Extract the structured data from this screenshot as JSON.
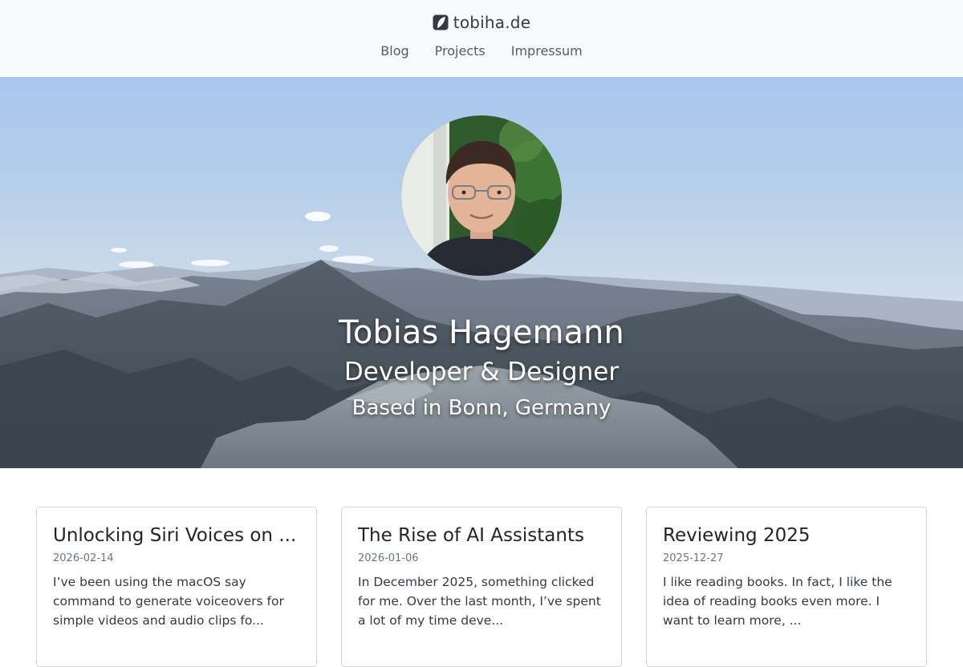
{
  "header": {
    "brand": "tobiha.de",
    "nav": [
      {
        "label": "Blog"
      },
      {
        "label": "Projects"
      },
      {
        "label": "Impressum"
      }
    ]
  },
  "hero": {
    "name": "Tobias Hagemann",
    "role": "Developer & Designer",
    "location": "Based in Bonn, Germany"
  },
  "posts": [
    {
      "title": "Unlocking Siri Voices on ...",
      "date": "2026-02-14",
      "excerpt": "I’ve been using the macOS say command to generate voiceovers for simple videos and audio clips fo..."
    },
    {
      "title": "The Rise of AI Assistants",
      "date": "2026-01-06",
      "excerpt": "In December 2025, something clicked for me. Over the last month, I’ve spent a lot of my time deve..."
    },
    {
      "title": "Reviewing 2025",
      "date": "2025-12-27",
      "excerpt": "I like reading books. In fact, I like the idea of reading books even more. I want to learn more, ..."
    }
  ]
}
